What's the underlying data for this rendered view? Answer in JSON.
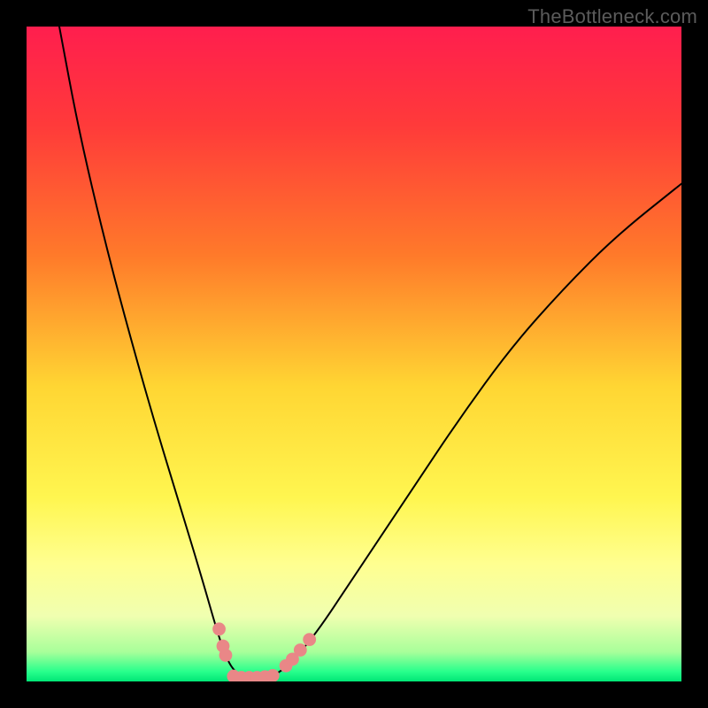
{
  "watermark": "TheBottleneck.com",
  "chart_data": {
    "type": "line",
    "title": "",
    "xlabel": "",
    "ylabel": "",
    "xlim": [
      0,
      100
    ],
    "ylim": [
      0,
      100
    ],
    "grid": false,
    "legend": false,
    "background_gradient_stops": [
      {
        "offset": 0.0,
        "color": "#ff1e4e"
      },
      {
        "offset": 0.15,
        "color": "#ff3a3a"
      },
      {
        "offset": 0.35,
        "color": "#ff7a2a"
      },
      {
        "offset": 0.55,
        "color": "#ffd633"
      },
      {
        "offset": 0.72,
        "color": "#fff650"
      },
      {
        "offset": 0.82,
        "color": "#ffff90"
      },
      {
        "offset": 0.9,
        "color": "#f0ffb0"
      },
      {
        "offset": 0.955,
        "color": "#a8ff9a"
      },
      {
        "offset": 0.985,
        "color": "#28ff8c"
      },
      {
        "offset": 1.0,
        "color": "#00e676"
      }
    ],
    "series": [
      {
        "name": "bottleneck-curve",
        "color": "#000000",
        "x": [
          5,
          8,
          12,
          16,
          20,
          24,
          27,
          29,
          30.5,
          32,
          34,
          36,
          38,
          40,
          44,
          50,
          58,
          66,
          74,
          82,
          90,
          100
        ],
        "y": [
          100,
          84,
          67,
          52,
          38,
          25,
          15,
          8,
          3.5,
          1.2,
          0.6,
          0.6,
          1.0,
          2.5,
          7,
          16,
          28,
          40,
          51,
          60,
          68,
          76
        ]
      }
    ],
    "markers": [
      {
        "name": "left-cluster",
        "color": "#e98787",
        "x": [
          29.4,
          30.0,
          30.4
        ],
        "y": [
          8.0,
          5.4,
          4.0
        ]
      },
      {
        "name": "bottom-cluster",
        "color": "#e98787",
        "x": [
          31.6,
          32.8,
          34.0,
          35.2,
          36.4,
          37.6
        ],
        "y": [
          0.8,
          0.6,
          0.6,
          0.6,
          0.7,
          0.9
        ]
      },
      {
        "name": "right-cluster",
        "color": "#e98787",
        "x": [
          39.6,
          40.6,
          41.8,
          43.2
        ],
        "y": [
          2.4,
          3.4,
          4.8,
          6.4
        ]
      }
    ],
    "annotations": []
  }
}
